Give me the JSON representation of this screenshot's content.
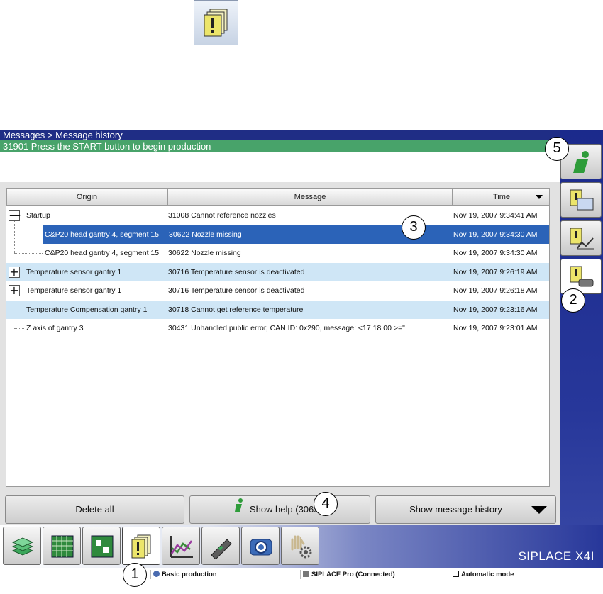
{
  "window": {
    "breadcrumb": "Messages > Message history",
    "status_message": "31901 Press the START button to begin production"
  },
  "table": {
    "columns": [
      "Origin",
      "Message",
      "Time"
    ],
    "rows": [
      {
        "origin": "Startup",
        "message": "31008 Cannot reference nozzles",
        "time": "Nov 19, 2007 9:34:41 AM",
        "expander": "—",
        "state": "normal"
      },
      {
        "origin": "C&P20 head gantry 4, segment 15",
        "message": "30622 Nozzle missing",
        "time": "Nov 19, 2007 9:34:30 AM",
        "expander": "",
        "state": "selected"
      },
      {
        "origin": "C&P20 head gantry 4, segment 15",
        "message": "30622 Nozzle missing",
        "time": "Nov 19, 2007 9:34:30 AM",
        "expander": "",
        "state": "normal"
      },
      {
        "origin": "Temperature sensor gantry 1",
        "message": "30716 Temperature sensor is deactivated",
        "time": "Nov 19, 2007 9:26:19 AM",
        "expander": "+",
        "state": "highlight"
      },
      {
        "origin": "Temperature sensor gantry 1",
        "message": "30716 Temperature sensor is deactivated",
        "time": "Nov 19, 2007 9:26:18 AM",
        "expander": "+",
        "state": "normal"
      },
      {
        "origin": "Temperature Compensation gantry 1",
        "message": "30718 Cannot get reference temperature",
        "time": "Nov 19, 2007 9:23:16 AM",
        "expander": "",
        "state": "highlight"
      },
      {
        "origin": "Z axis of gantry 3",
        "message": "30431 Unhandled public error, CAN ID: 0x290, message: <17 18 00 >=\"",
        "time": "Nov 19, 2007 9:23:01 AM",
        "expander": "",
        "state": "normal"
      }
    ]
  },
  "buttons": {
    "delete_all": "Delete all",
    "show_help": "Show help (30622)",
    "show_history": "Show message history"
  },
  "brand": "SIPLACE X4I",
  "footer": {
    "mode": "Basic production",
    "connection": "SIPLACE Pro (Connected)",
    "operation": "Automatic mode"
  },
  "callouts": {
    "c1": "1",
    "c2": "2",
    "c3": "3",
    "c4": "4",
    "c5": "5"
  },
  "colors": {
    "title_bar": "#1f2d85",
    "status_bar": "#48a36a",
    "selection": "#2b63b8",
    "row_highlight": "#cfe6f6"
  },
  "icons": {
    "right_panel": [
      "info-icon",
      "message-monitor-icon",
      "message-chart-icon",
      "message-history-icon"
    ],
    "nav": [
      "stack-icon",
      "grid-icon",
      "board-icon",
      "messages-icon",
      "chart-icon",
      "feeder-icon",
      "camera-icon",
      "hand-gear-icon"
    ]
  }
}
